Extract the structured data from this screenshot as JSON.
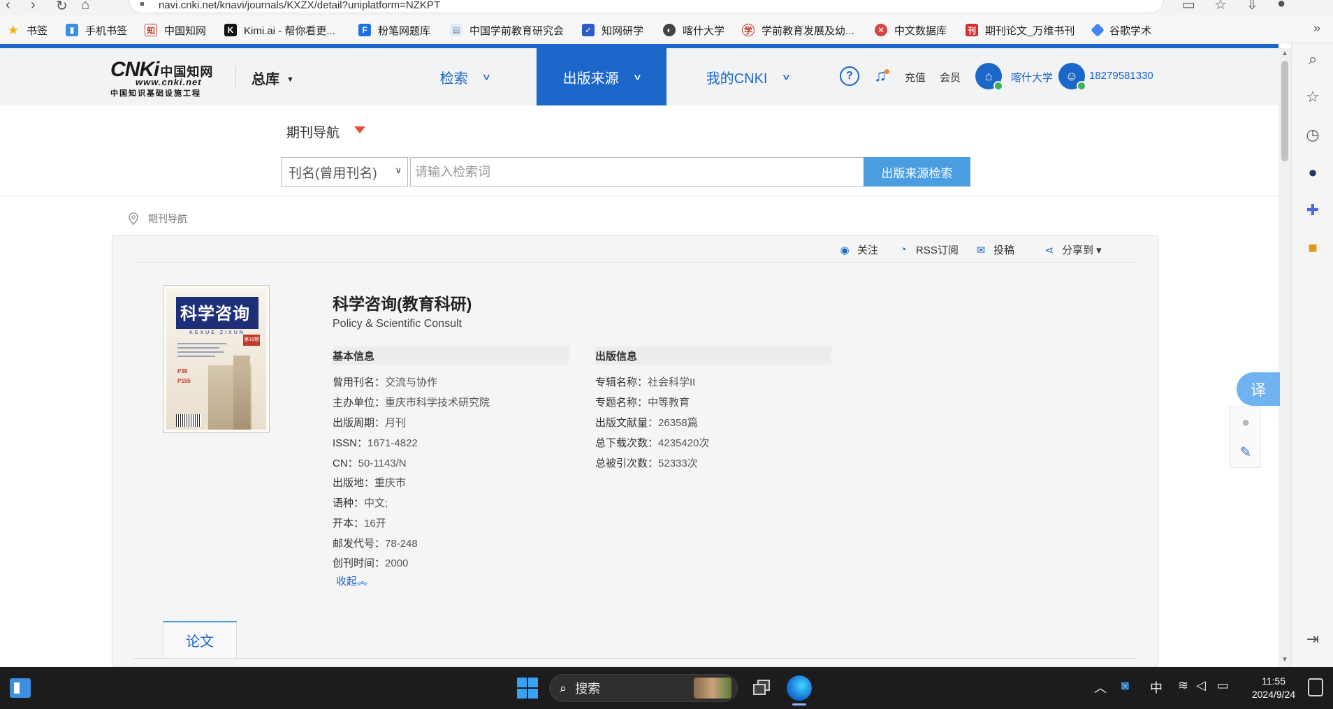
{
  "browser": {
    "url": "navi.cnki.net/knavi/journals/KXZX/detail?uniplatform=NZKPT",
    "bookmarks": [
      {
        "label": "书签",
        "icon": "star-icon",
        "color": "#f5b400"
      },
      {
        "label": "手机书签",
        "icon": "mobile-bookmark-icon",
        "color": "#3b8ee0"
      },
      {
        "label": "中国知网",
        "icon": "cnki-icon",
        "color": "#c0392b"
      },
      {
        "label": "Kimi.ai - 帮你看更...",
        "icon": "kimi-icon",
        "color": "#111111"
      },
      {
        "label": "粉笔网题库",
        "icon": "fenbi-icon",
        "color": "#1f6fe5"
      },
      {
        "label": "中国学前教育研究会",
        "icon": "page-icon",
        "color": "#7a8ea8"
      },
      {
        "label": "知网研学",
        "icon": "yanxue-icon",
        "color": "#2c5ac9"
      },
      {
        "label": "喀什大学",
        "icon": "kashi-icon",
        "color": "#444444"
      },
      {
        "label": "学前教育发展及幼...",
        "icon": "edu-icon",
        "color": "#c0392b"
      },
      {
        "label": "中文数据库",
        "icon": "db-icon",
        "color": "#d64545"
      },
      {
        "label": "期刊论文_万维书刊",
        "icon": "wanwei-icon",
        "color": "#d62d2d"
      },
      {
        "label": "谷歌学术",
        "icon": "scholar-icon",
        "color": "#4285f4"
      }
    ],
    "more_glyph": "»"
  },
  "header": {
    "logo_main": "CNKi",
    "logo_cn": "中国知网",
    "logo_url": "www.cnki.net",
    "logo_tagline": "中国知识基础设施工程",
    "db_select": "总库",
    "nav": [
      {
        "label": "检索",
        "active": false
      },
      {
        "label": "出版来源",
        "active": true
      },
      {
        "label": "我的CNKI",
        "active": false
      }
    ],
    "help": "?",
    "recharge": "充值",
    "member": "会员",
    "institution": "喀什大学",
    "user": "18279581330"
  },
  "search": {
    "nav_title": "期刊导航",
    "field_selected": "刊名(曾用刊名)",
    "placeholder": "请输入检索词",
    "button": "出版来源检索"
  },
  "breadcrumb": "期刊导航",
  "toolbar": {
    "follow": "关注",
    "rss": "RSS订阅",
    "submit": "投稿",
    "share": "分享到 ▾"
  },
  "cover": {
    "title": "科学咨询",
    "sub": "KEXUE ZIXUN",
    "issue": "第16期"
  },
  "journal": {
    "title": "科学咨询(教育科研)",
    "english_title": "Policy & Scientific Consult",
    "basic_head": "基本信息",
    "basic": [
      {
        "label": "曾用刊名：",
        "value": "交流与协作"
      },
      {
        "label": "主办单位：",
        "value": "重庆市科学技术研究院"
      },
      {
        "label": "出版周期：",
        "value": "月刊"
      },
      {
        "label": "ISSN：",
        "value": "1671-4822"
      },
      {
        "label": "CN：",
        "value": "50-1143/N"
      },
      {
        "label": "出版地：",
        "value": "重庆市"
      },
      {
        "label": "语种：",
        "value": "中文;"
      },
      {
        "label": "开本：",
        "value": "16开"
      },
      {
        "label": "邮发代号：",
        "value": "78-248"
      },
      {
        "label": "创刊时间：",
        "value": "2000"
      }
    ],
    "pub_head": "出版信息",
    "pub": [
      {
        "label": "专辑名称：",
        "value": "社会科学II"
      },
      {
        "label": "专题名称：",
        "value": "中等教育"
      },
      {
        "label": "出版文献量：",
        "value": "26358篇"
      },
      {
        "label": "总下载次数：",
        "value": "4235420次"
      },
      {
        "label": "总被引次数：",
        "value": "52333次"
      }
    ],
    "collapse": "收起︽"
  },
  "tabs": {
    "papers": "论文"
  },
  "float": {
    "translate": "译"
  },
  "taskbar": {
    "search_label": "搜索",
    "ime": "中",
    "time": "11:55",
    "date": "2024/9/24"
  }
}
